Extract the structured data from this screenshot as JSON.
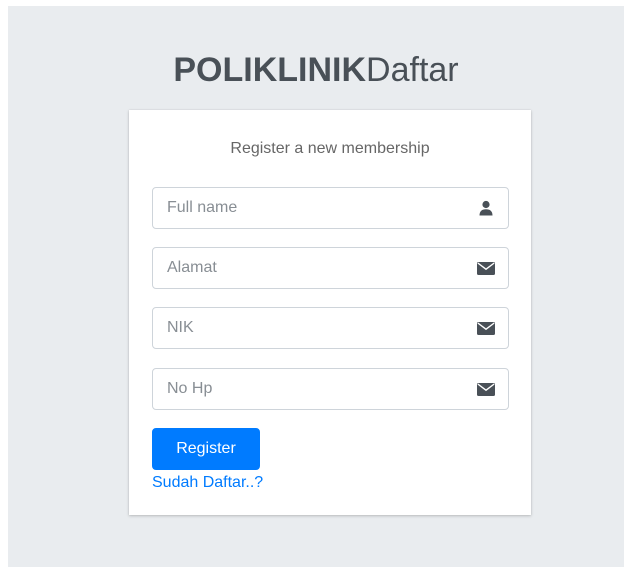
{
  "brand": {
    "bold": "POLIKLINIK",
    "light": "Daftar"
  },
  "card": {
    "title": "Register a new membership"
  },
  "form": {
    "fullname": {
      "placeholder": "Full name",
      "icon": "user-icon"
    },
    "alamat": {
      "placeholder": "Alamat",
      "icon": "envelope-icon"
    },
    "nik": {
      "placeholder": "NIK",
      "icon": "envelope-icon"
    },
    "nohp": {
      "placeholder": "No Hp",
      "icon": "envelope-icon"
    }
  },
  "actions": {
    "register_label": "Register",
    "login_link": "Sudah Daftar..?"
  },
  "colors": {
    "primary": "#007bff",
    "background": "#e9ecef",
    "icon": "#495057"
  }
}
